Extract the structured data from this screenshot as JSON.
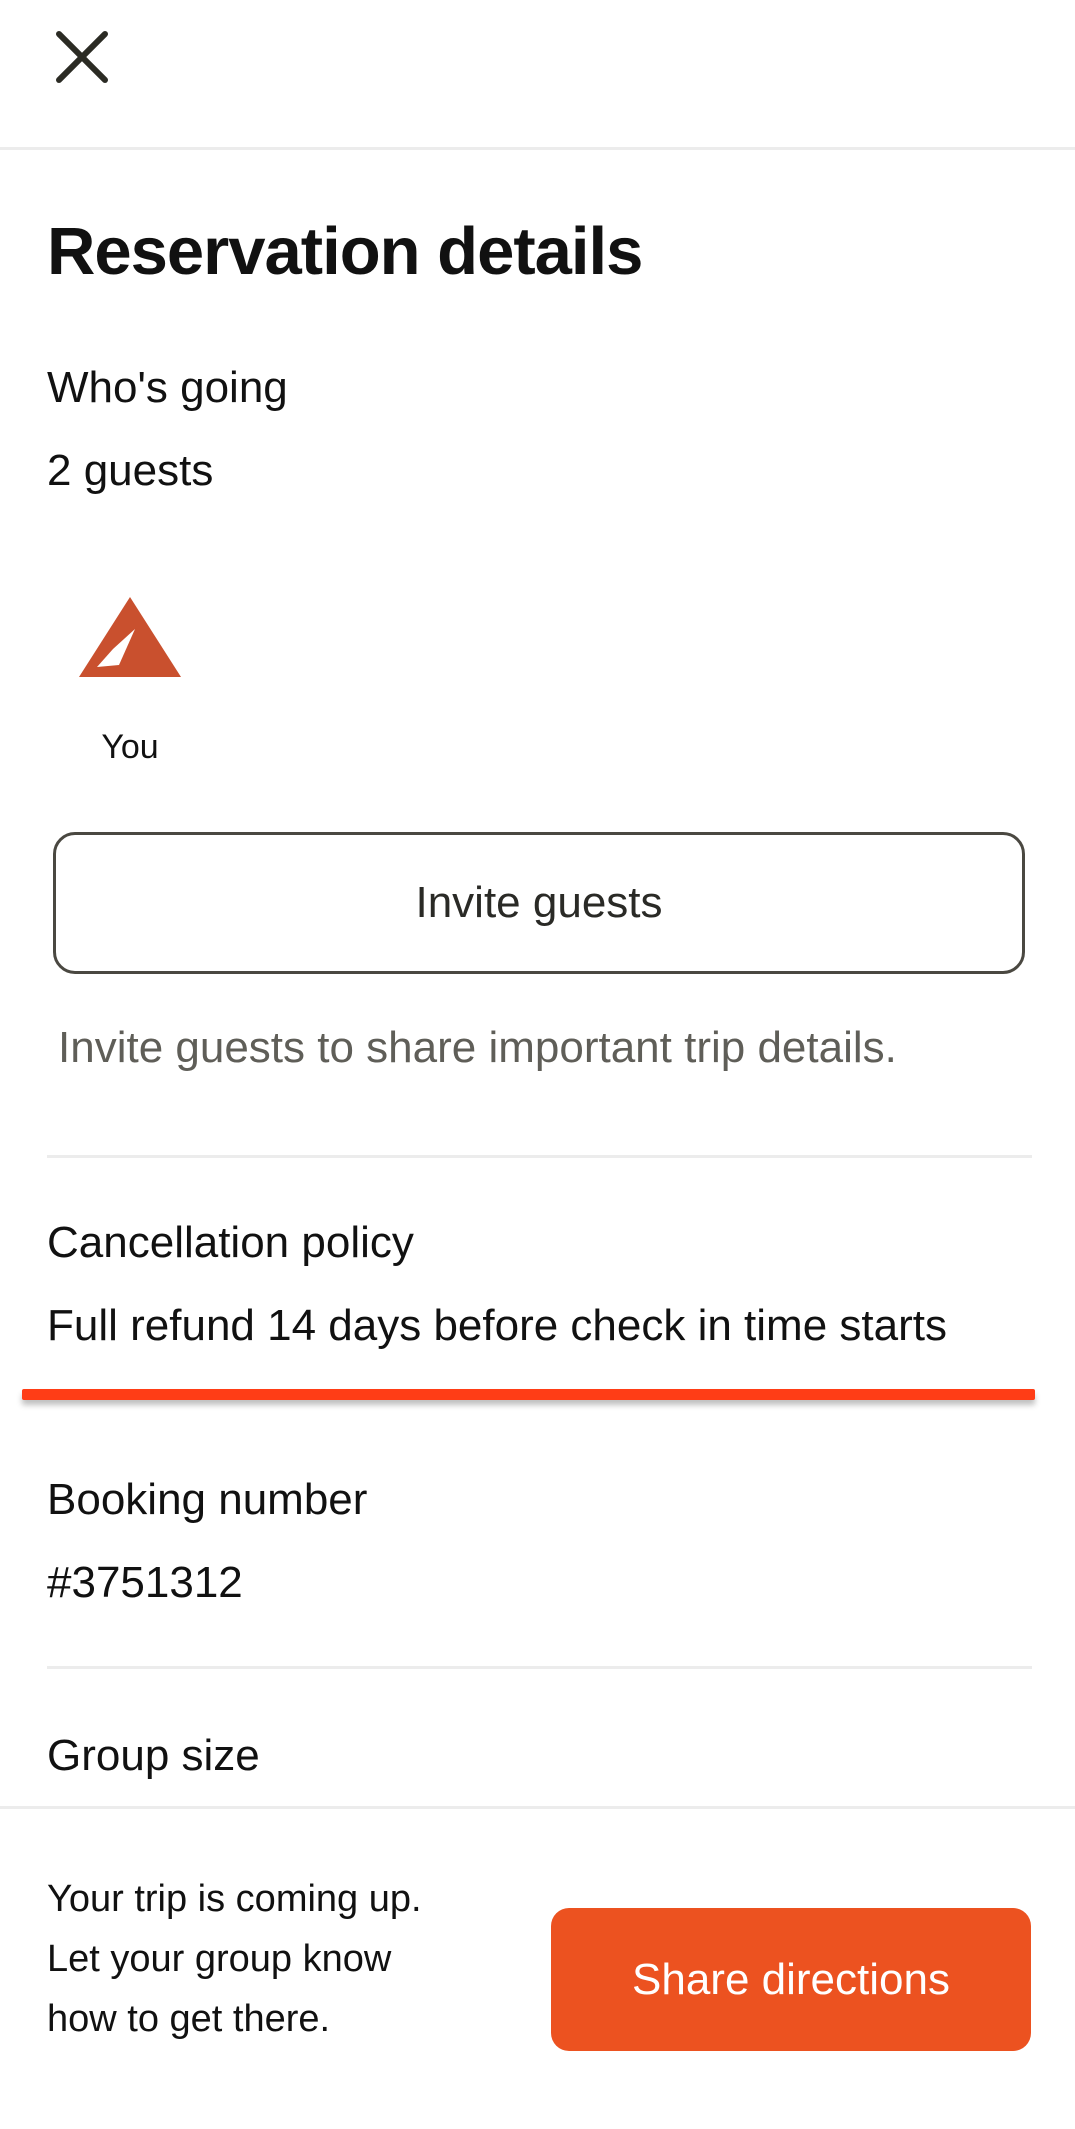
{
  "header": {
    "close_icon": "close-icon"
  },
  "page": {
    "title": "Reservation details"
  },
  "guests": {
    "label": "Who's going",
    "count_text": "2 guests",
    "avatar_icon": "tent-icon",
    "avatar_name": "You",
    "invite_button_label": "Invite guests",
    "invite_hint": "Invite guests to share important trip details."
  },
  "cancellation": {
    "label": "Cancellation policy",
    "value": "Full refund 14 days before check in time starts"
  },
  "booking": {
    "label": "Booking number",
    "value": "#3751312"
  },
  "group": {
    "label": "Group size"
  },
  "footer": {
    "line1": "Your trip is coming up.",
    "line2": "Let your group know how to get there.",
    "share_button_label": "Share directions"
  },
  "colors": {
    "accent": "#ec5220",
    "avatar": "#c9502e",
    "highlight": "#ff3d16",
    "divider": "#ececec"
  }
}
